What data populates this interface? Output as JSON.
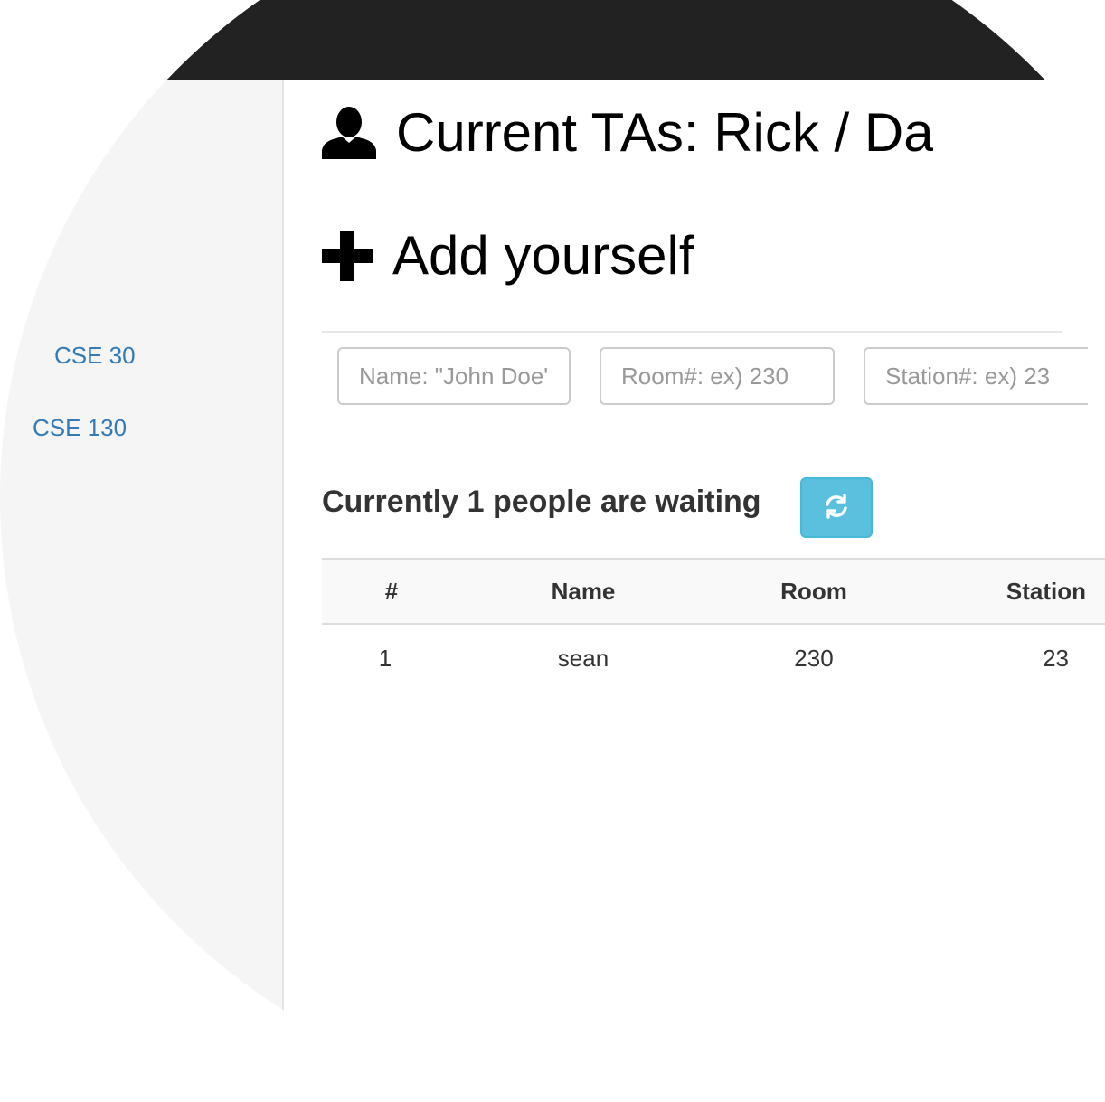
{
  "sidebar": {
    "items": [
      {
        "label": "CSE 30"
      },
      {
        "label": "CSE 130"
      }
    ]
  },
  "main": {
    "current_tas": "Current TAs: Rick / Dave",
    "add_yourself": "Add yourself",
    "form": {
      "name_placeholder": "Name: \"John Doe\"",
      "room_placeholder": "Room#: ex) 230",
      "station_placeholder": "Station#: ex) 23"
    },
    "waiting_text": "Currently 1 people are waiting",
    "table": {
      "headers": [
        "#",
        "Name",
        "Room",
        "Station"
      ],
      "rows": [
        {
          "num": "1",
          "name": "sean",
          "room": "230",
          "station": "23"
        }
      ]
    }
  },
  "icons": {
    "user": "user-icon",
    "plus": "plus-icon",
    "refresh": "refresh-icon"
  },
  "colors": {
    "navbar": "#222222",
    "link": "#337ab7",
    "refresh_button": "#5bc0de"
  }
}
